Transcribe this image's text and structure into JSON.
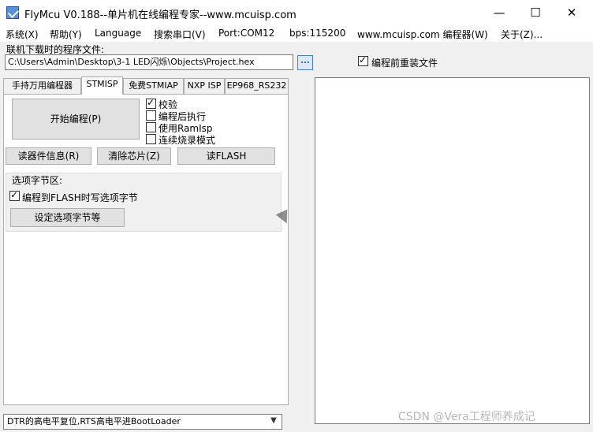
{
  "window": {
    "title": "FlyMcu V0.188--单片机在线编程专家--www.mcuisp.com",
    "minimize": "—",
    "maximize": "☐",
    "close": "✕"
  },
  "menu": [
    "系统(X)",
    "帮助(Y)",
    "Language",
    "搜索串口(V)",
    "Port:COM12",
    "bps:115200",
    "www.mcuisp.com 编程器(W)",
    "关于(Z)..."
  ],
  "file": {
    "label": "联机下载时的程序文件:",
    "path": "C:\\Users\\Admin\\Desktop\\3-1 LED闪烁\\Objects\\Project.hex",
    "browse_label": "...",
    "reload_label": "编程前重装文件",
    "reload_checked": true
  },
  "tabs": [
    {
      "label": "手持万用编程器",
      "active": false
    },
    {
      "label": "STMISP",
      "active": true
    },
    {
      "label": "免费STMIAP",
      "active": false
    },
    {
      "label": "NXP ISP",
      "active": false
    },
    {
      "label": "EP968_RS232",
      "active": false
    }
  ],
  "stmisp": {
    "start_button": "开始编程(P)",
    "options": [
      {
        "label": "校验",
        "checked": true
      },
      {
        "label": "编程后执行",
        "checked": false
      },
      {
        "label": "使用RamIsp",
        "checked": false
      },
      {
        "label": "连续烧录模式",
        "checked": false
      }
    ],
    "read_info_button": "读器件信息(R)",
    "erase_button": "清除芯片(Z)",
    "read_flash_button": "读FLASH",
    "option_group": {
      "title": "选项字节区:",
      "flash_checkbox_label": "编程到FLASH时写选项字节",
      "flash_checked": true,
      "set_button": "设定选项字节等"
    }
  },
  "reset_mode": {
    "selected": "DTR的高电平复位,RTS高电平进BootLoader"
  },
  "watermark": "CSDN @Vera工程师养成记"
}
